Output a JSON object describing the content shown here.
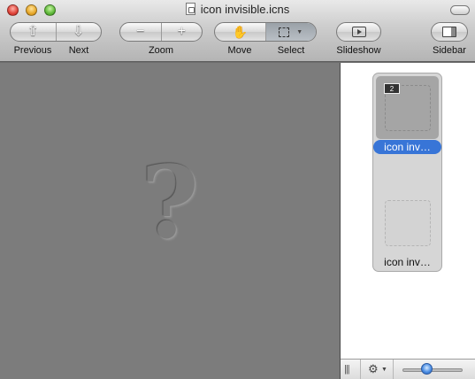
{
  "window": {
    "title": "icon invisible.icns"
  },
  "toolbar": {
    "previous_label": "Previous",
    "next_label": "Next",
    "zoom_label": "Zoom",
    "zoom_out_glyph": "−",
    "zoom_in_glyph": "+",
    "move_label": "Move",
    "select_label": "Select",
    "slideshow_label": "Slideshow",
    "sidebar_label": "Sidebar"
  },
  "viewer": {
    "placeholder_glyph": "?"
  },
  "sidebar": {
    "items": [
      {
        "label": "icon inv…",
        "badge": "2",
        "selected": true
      },
      {
        "label": "icon inv…",
        "selected": false
      }
    ],
    "thumbnail_size_fraction": 0.4
  },
  "colors": {
    "selection": "#3875d7",
    "viewer_background": "#7c7c7c"
  }
}
